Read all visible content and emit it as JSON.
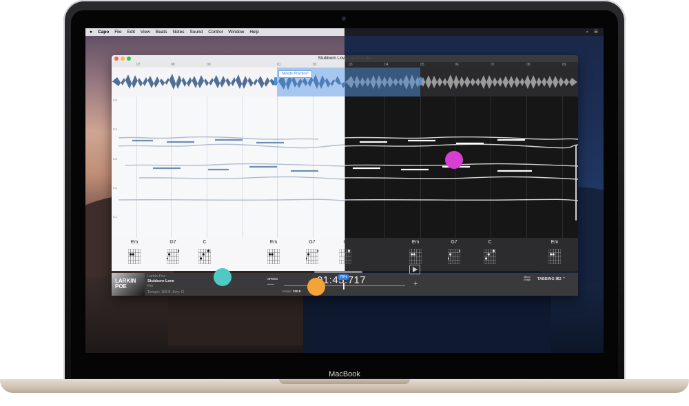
{
  "menubar": {
    "app_name": "Capo",
    "items": [
      "File",
      "Edit",
      "View",
      "Beats",
      "Notes",
      "Sound",
      "Control",
      "Window",
      "Help"
    ]
  },
  "window": {
    "title": "Stubborn Love.capobundle"
  },
  "timeline": {
    "left_ticks": [
      "07",
      "08",
      "09",
      "01",
      "02"
    ],
    "right_ticks": [
      "03",
      "04",
      "05",
      "06",
      "07",
      "08",
      "09"
    ]
  },
  "selection": {
    "label": "Needs Practice!"
  },
  "spectrogram": {
    "octave_labels": [
      "C5",
      "C4",
      "C3",
      "C2",
      "C1"
    ]
  },
  "chords": [
    {
      "name": "Em"
    },
    {
      "name": "G7"
    },
    {
      "name": "C"
    },
    {
      "name": "Em"
    },
    {
      "name": "G7"
    },
    {
      "name": "C"
    },
    {
      "name": "Em"
    },
    {
      "name": "G7"
    },
    {
      "name": "C"
    },
    {
      "name": "Em"
    }
  ],
  "album": {
    "cover_text_line1": "LARKIN",
    "cover_text_line2": "POE"
  },
  "track": {
    "artist": "Larkin Poe",
    "title": "Stubborn Love",
    "sub": "Kin",
    "tempo_key": "Tempo: 103.8, Key: G"
  },
  "transport": {
    "time": "01:45.717",
    "speed_label": "SPEED",
    "speed_percent": "78%",
    "tempo_label": "tempo:",
    "tempo_value": "100.8",
    "minus": "—",
    "plus": "+"
  },
  "tabbing": {
    "label": "TABBING ⌘2 ⌃"
  },
  "device": {
    "brand": "MacBook"
  },
  "annotations": {
    "colors": [
      "#d63fd1",
      "#4fc9c4",
      "#f4a338"
    ]
  }
}
